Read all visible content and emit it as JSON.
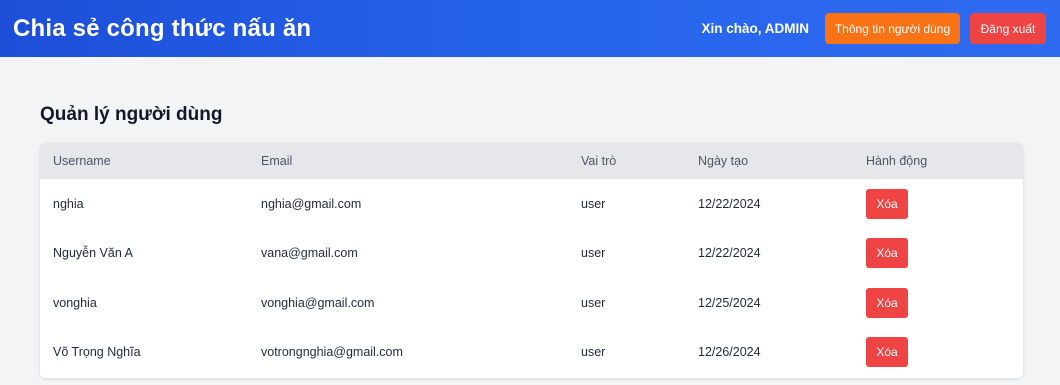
{
  "header": {
    "brand": "Chia sẻ công thức nấu ăn",
    "greeting": "Xin chào, ADMIN",
    "profile_button": "Thông tin người dùng",
    "logout_button": "Đăng xuất"
  },
  "page": {
    "title": "Quản lý người dùng"
  },
  "table": {
    "headers": [
      "Username",
      "Email",
      "Vai trò",
      "Ngày tạo",
      "Hành động"
    ],
    "rows": [
      {
        "username": "nghia",
        "email": "nghia@gmail.com",
        "role": "user",
        "created": "12/22/2024",
        "action": "Xóa"
      },
      {
        "username": "Nguyễn Văn A",
        "email": "vana@gmail.com",
        "role": "user",
        "created": "12/22/2024",
        "action": "Xóa"
      },
      {
        "username": "vonghia",
        "email": "vonghia@gmail.com",
        "role": "user",
        "created": "12/25/2024",
        "action": "Xóa"
      },
      {
        "username": "Võ Trọng Nghĩa",
        "email": "votrongnghia@gmail.com",
        "role": "user",
        "created": "12/26/2024",
        "action": "Xóa"
      }
    ]
  }
}
